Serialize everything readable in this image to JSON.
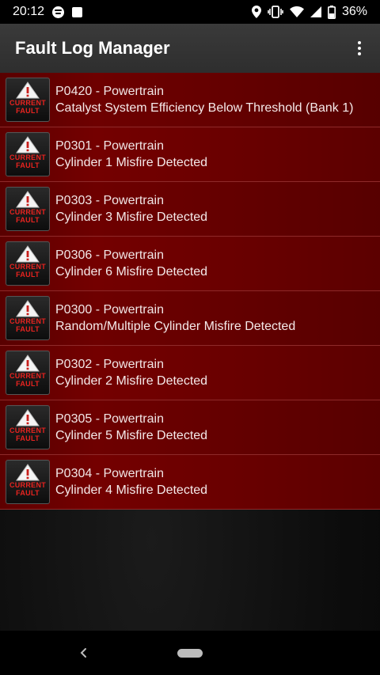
{
  "status_bar": {
    "time": "20:12",
    "battery": "36%",
    "icons": [
      "spotify-icon",
      "square-notification-icon",
      "location-icon",
      "vibrate-icon",
      "wifi-icon",
      "signal-icon",
      "battery-icon"
    ]
  },
  "app_bar": {
    "title": "Fault Log Manager",
    "menu_icon": "overflow-menu-icon"
  },
  "badge": {
    "line1": "CURRENT",
    "line2": "FAULT",
    "icon": "warning-triangle-icon",
    "color": "#e8231f"
  },
  "faults": [
    {
      "code": "P0420 - Powertrain",
      "description": "Catalyst System Efficiency Below Threshold (Bank 1)"
    },
    {
      "code": "P0301 - Powertrain",
      "description": "Cylinder 1 Misfire Detected"
    },
    {
      "code": "P0303 - Powertrain",
      "description": "Cylinder 3 Misfire Detected"
    },
    {
      "code": "P0306 - Powertrain",
      "description": "Cylinder 6 Misfire Detected"
    },
    {
      "code": "P0300 - Powertrain",
      "description": "Random/Multiple Cylinder Misfire Detected"
    },
    {
      "code": "P0302 - Powertrain",
      "description": "Cylinder 2 Misfire Detected"
    },
    {
      "code": "P0305 - Powertrain",
      "description": "Cylinder 5 Misfire Detected"
    },
    {
      "code": "P0304 - Powertrain",
      "description": "Cylinder 4 Misfire Detected"
    }
  ],
  "nav_bar": {
    "back_icon": "back-chevron-icon",
    "home_icon": "home-pill-icon"
  }
}
